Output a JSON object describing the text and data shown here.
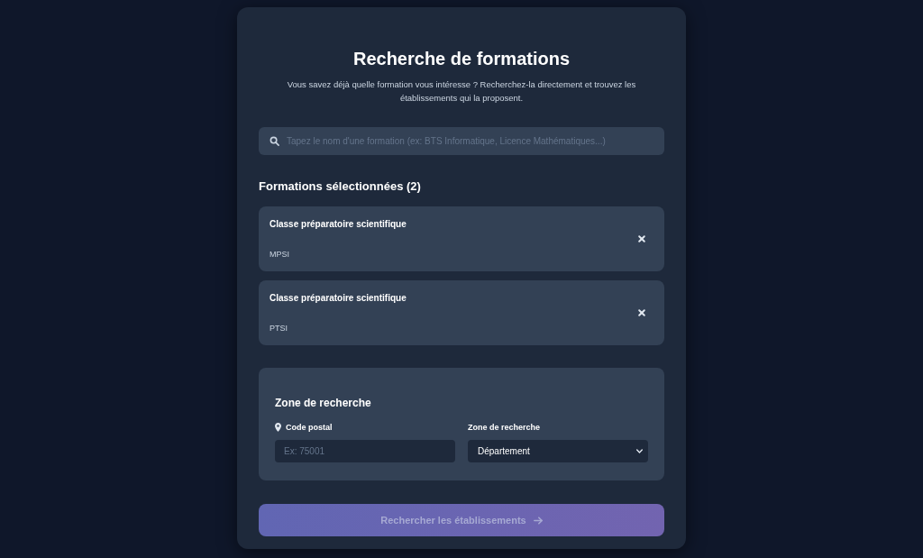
{
  "header": {
    "title": "Recherche de formations",
    "subtitle": "Vous savez déjà quelle formation vous intéresse ? Recherchez-la directement et trouvez les établissements qui la proposent."
  },
  "search": {
    "placeholder": "Tapez le nom d'une formation (ex: BTS Informatique, Licence Mathématiques...)"
  },
  "selected": {
    "heading": "Formations sélectionnées (2)",
    "items": [
      {
        "title": "Classe préparatoire scientifique",
        "code": "MPSI"
      },
      {
        "title": "Classe préparatoire scientifique",
        "code": "PTSI"
      }
    ]
  },
  "zone": {
    "heading": "Zone de recherche",
    "postal": {
      "label": "Code postal",
      "placeholder": "Ex: 75001"
    },
    "area": {
      "label": "Zone de recherche",
      "value": "Département"
    }
  },
  "submit": {
    "label": "Rechercher les établissements",
    "disabled": true
  }
}
